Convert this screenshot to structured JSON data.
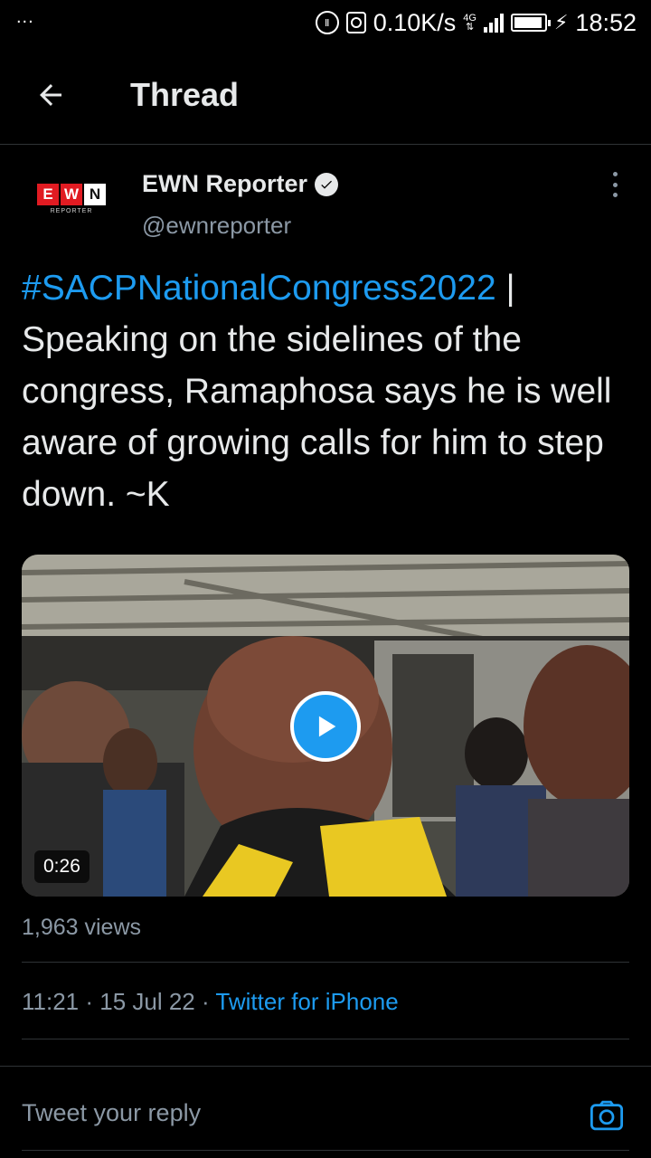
{
  "status_bar": {
    "dots": "...",
    "net_speed": "0.10K/s",
    "network_type": "4G",
    "time": "18:52",
    "battery_level": 0.95
  },
  "header": {
    "title": "Thread",
    "back_icon": "arrow-left-icon"
  },
  "tweet": {
    "author": {
      "name": "EWN Reporter",
      "handle": "@ewnreporter",
      "verified": true,
      "avatar_logo": {
        "letters": [
          "E",
          "W",
          "N"
        ],
        "subtitle": "REPORTER"
      }
    },
    "text": {
      "hashtag": "#SACPNationalCongress2022",
      "body": " | Speaking on the sidelines of the congress, Ramaphosa says he is well aware of growing calls for him to step down. ~K"
    },
    "video": {
      "duration": "0:26"
    },
    "views": "1,963 views",
    "timestamp": "11:21 · 15 Jul 22 · ",
    "source": "Twitter for iPhone"
  },
  "reply": {
    "placeholder": "Tweet your reply",
    "camera_icon": "camera-icon"
  },
  "colors": {
    "accent": "#1d9bf0",
    "background": "#000000",
    "text": "#e7e9ea",
    "secondary": "#8b98a5",
    "divider": "#2f3336"
  }
}
